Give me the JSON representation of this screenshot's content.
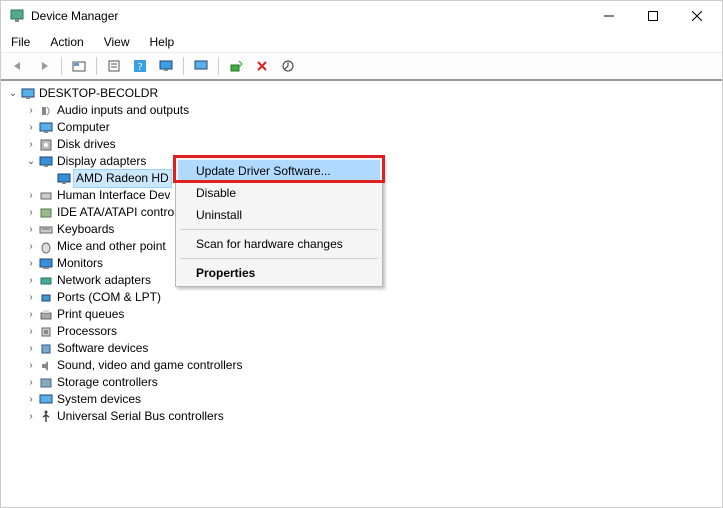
{
  "window": {
    "title": "Device Manager"
  },
  "menubar": [
    "File",
    "Action",
    "View",
    "Help"
  ],
  "toolbar_icons": [
    "back-icon",
    "forward-icon",
    "sep",
    "show-hidden-icon",
    "sep",
    "properties-icon",
    "help-icon",
    "computer-icon",
    "sep",
    "scan-hardware-icon",
    "sep",
    "add-device-icon",
    "remove-icon",
    "update-icon"
  ],
  "tree": {
    "root": "DESKTOP-BECOLDR",
    "nodes": [
      {
        "label": "Audio inputs and outputs",
        "icon": "audio",
        "expandable": true
      },
      {
        "label": "Computer",
        "icon": "computer",
        "expandable": true
      },
      {
        "label": "Disk drives",
        "icon": "disk",
        "expandable": true
      },
      {
        "label": "Display adapters",
        "icon": "display",
        "expandable": true,
        "expanded": true,
        "children": [
          {
            "label": "AMD Radeon HD",
            "icon": "display",
            "selected": true
          }
        ]
      },
      {
        "label": "Human Interface Dev",
        "icon": "hid",
        "expandable": true,
        "truncated": true
      },
      {
        "label": "IDE ATA/ATAPI contro",
        "icon": "ide",
        "expandable": true,
        "truncated": true
      },
      {
        "label": "Keyboards",
        "icon": "keyboard",
        "expandable": true
      },
      {
        "label": "Mice and other point",
        "icon": "mouse",
        "expandable": true,
        "truncated": true
      },
      {
        "label": "Monitors",
        "icon": "monitor",
        "expandable": true
      },
      {
        "label": "Network adapters",
        "icon": "network",
        "expandable": true
      },
      {
        "label": "Ports (COM & LPT)",
        "icon": "port",
        "expandable": true
      },
      {
        "label": "Print queues",
        "icon": "printer",
        "expandable": true
      },
      {
        "label": "Processors",
        "icon": "cpu",
        "expandable": true
      },
      {
        "label": "Software devices",
        "icon": "software",
        "expandable": true
      },
      {
        "label": "Sound, video and game controllers",
        "icon": "sound",
        "expandable": true
      },
      {
        "label": "Storage controllers",
        "icon": "storage",
        "expandable": true
      },
      {
        "label": "System devices",
        "icon": "system",
        "expandable": true
      },
      {
        "label": "Universal Serial Bus controllers",
        "icon": "usb",
        "expandable": true
      }
    ]
  },
  "context_menu": {
    "items": [
      {
        "label": "Update Driver Software...",
        "hover": true
      },
      {
        "label": "Disable"
      },
      {
        "label": "Uninstall"
      },
      {
        "sep": true
      },
      {
        "label": "Scan for hardware changes"
      },
      {
        "sep": true
      },
      {
        "label": "Properties",
        "bold": true
      }
    ]
  }
}
